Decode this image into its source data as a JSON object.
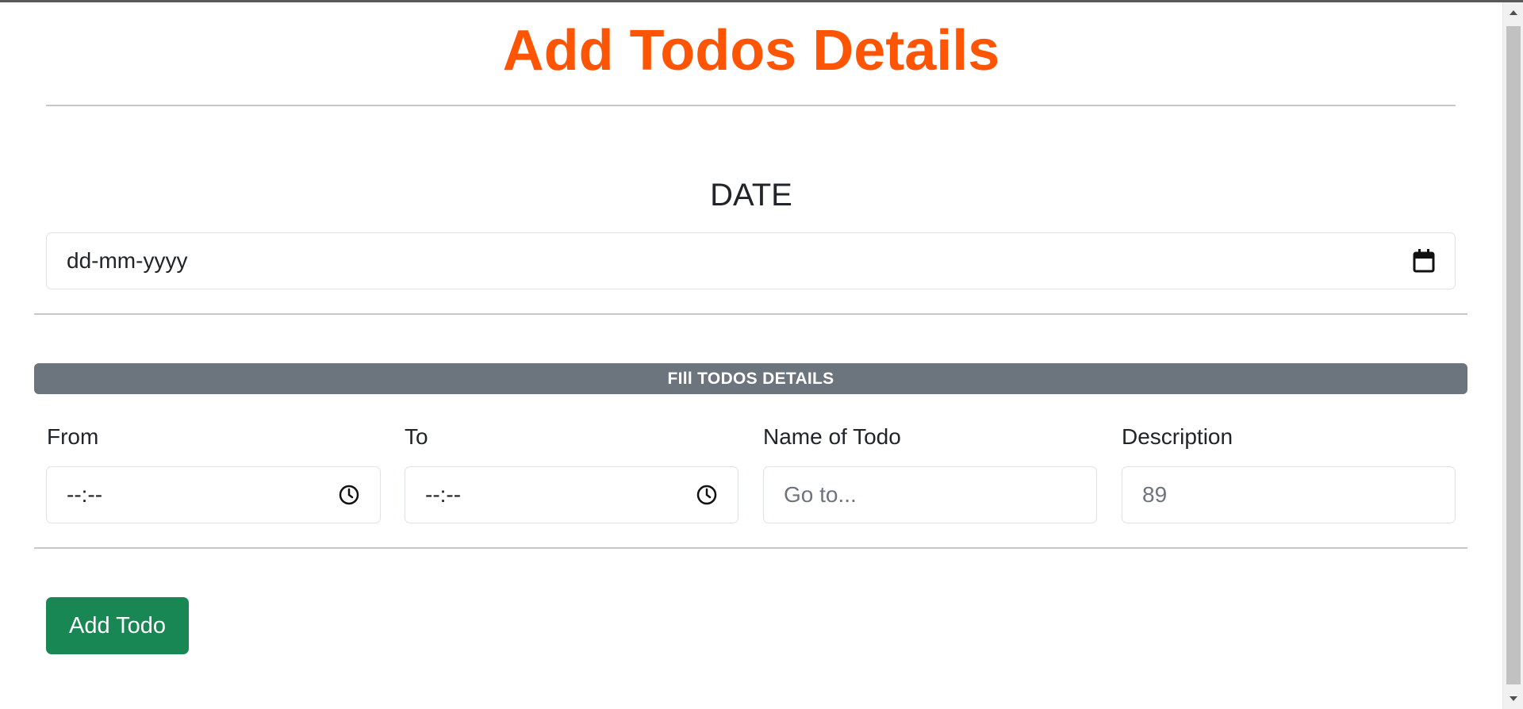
{
  "header": {
    "title": "Add Todos Details"
  },
  "date_section": {
    "label": "DATE",
    "date_input_value": "dd-mm-yyyy"
  },
  "details": {
    "banner": "FIll TODOS DETAILS",
    "from": {
      "label": "From",
      "value": "--:--"
    },
    "to": {
      "label": "To",
      "value": "--:--"
    },
    "name": {
      "label": "Name of Todo",
      "placeholder": "Go to..."
    },
    "description": {
      "label": "Description",
      "placeholder": "89"
    }
  },
  "actions": {
    "add_label": "Add Todo"
  },
  "colors": {
    "title": "#fd5504",
    "banner": "#6c757d",
    "add_button": "#198754"
  }
}
